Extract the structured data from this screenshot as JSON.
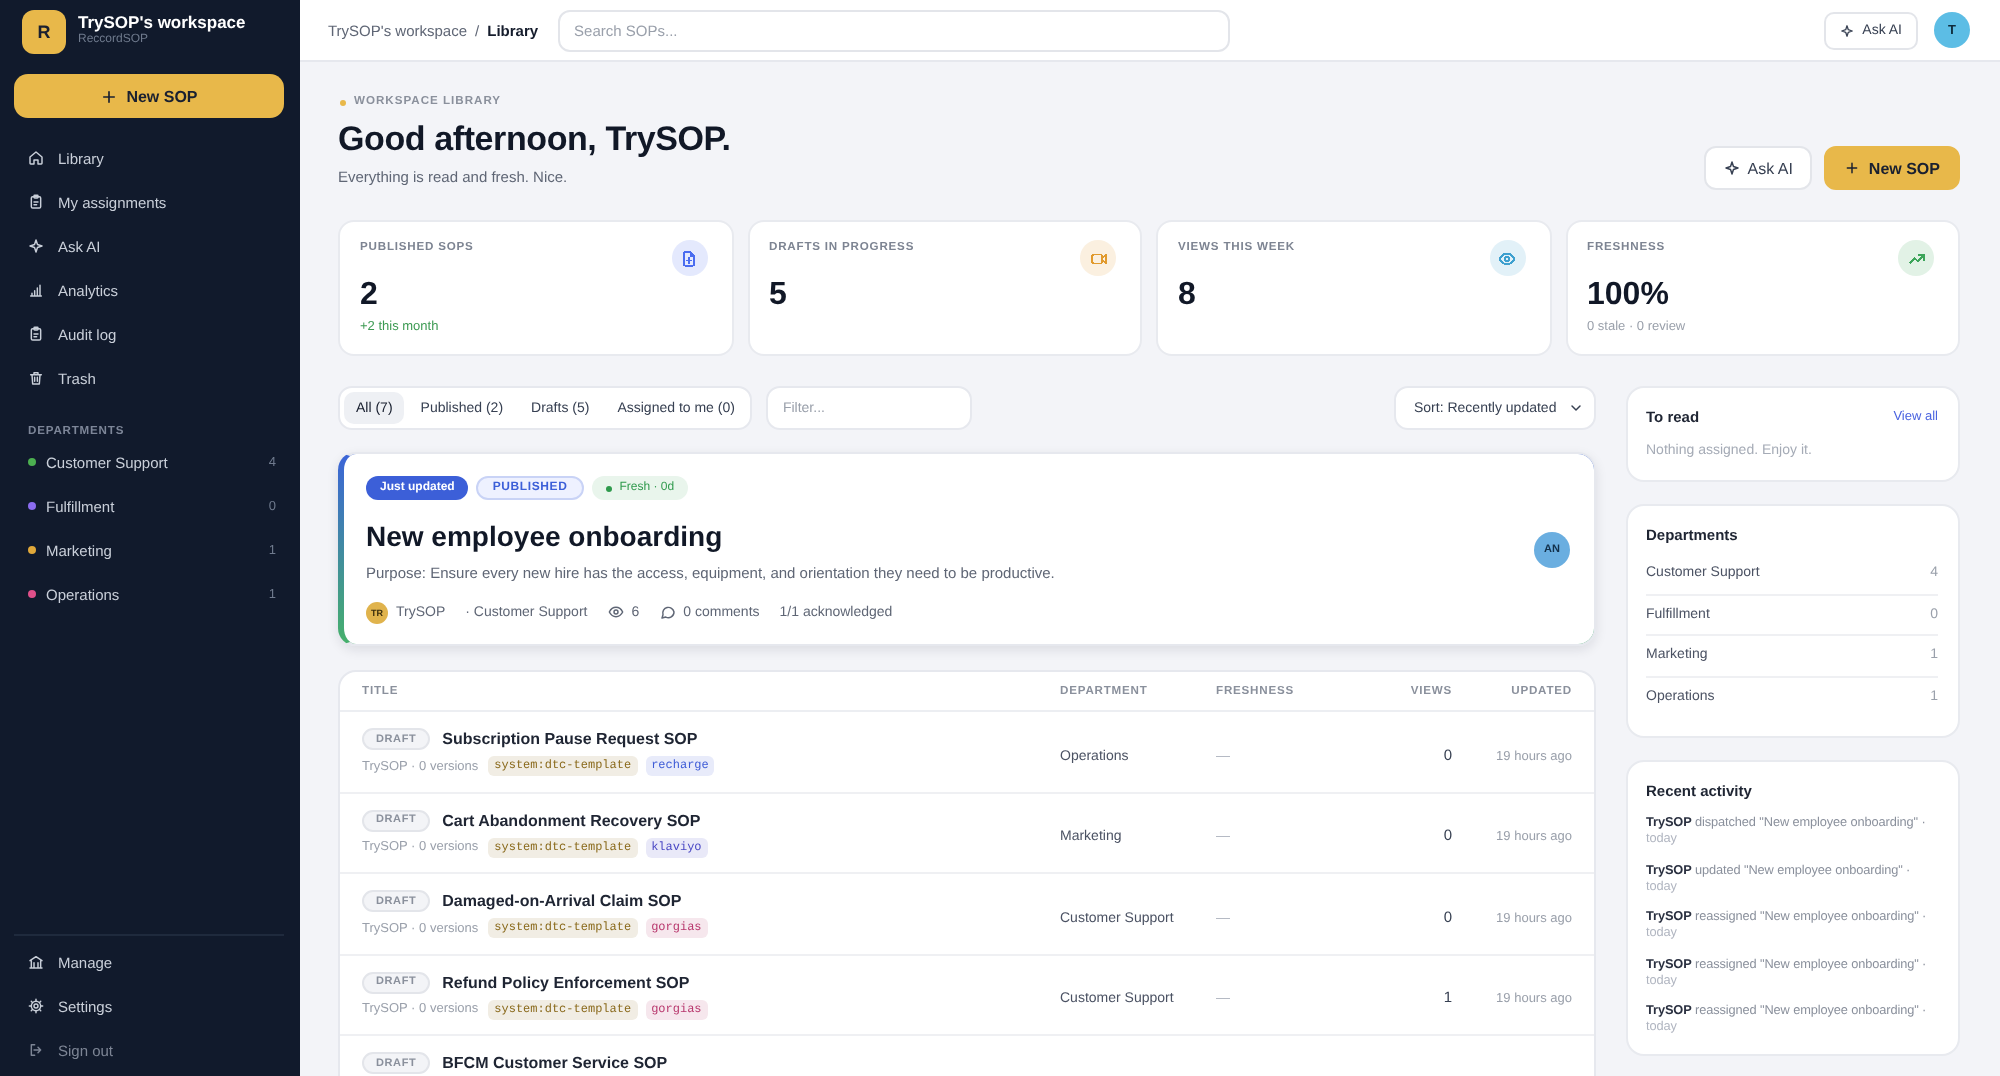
{
  "sidebar": {
    "workspace": {
      "logo_letter": "R",
      "name": "TrySOP's workspace",
      "product": "ReccordSOP"
    },
    "new_button": "New SOP",
    "nav": [
      {
        "label": "Library"
      },
      {
        "label": "My assignments"
      },
      {
        "label": "Ask AI"
      },
      {
        "label": "Analytics"
      },
      {
        "label": "Audit log"
      },
      {
        "label": "Trash"
      }
    ],
    "departments_heading": "DEPARTMENTS",
    "departments": [
      {
        "name": "Customer Support",
        "count": "4",
        "color": "#4caf50"
      },
      {
        "name": "Fulfillment",
        "count": "0",
        "color": "#8b6cf0"
      },
      {
        "name": "Marketing",
        "count": "1",
        "color": "#e0a83a"
      },
      {
        "name": "Operations",
        "count": "1",
        "color": "#e0508a"
      }
    ],
    "footer_nav": [
      {
        "label": "Manage",
        "dimmed": false
      },
      {
        "label": "Settings",
        "dimmed": false
      },
      {
        "label": "Sign out",
        "dimmed": true
      }
    ]
  },
  "topbar": {
    "breadcrumb": [
      {
        "label": "TrySOP's workspace",
        "current": false
      },
      {
        "label": "Library",
        "current": true
      }
    ],
    "separator": "/",
    "search": {
      "placeholder": "Search SOPs..."
    },
    "ask_ai": "Ask AI",
    "avatar": "T"
  },
  "header": {
    "eyebrow": "WORKSPACE LIBRARY",
    "title": "Good afternoon, TrySOP.",
    "subtitle": "Everything is read and fresh. Nice.",
    "buttons": [
      {
        "label": "Ask AI",
        "kind": "secondary"
      },
      {
        "label": "New SOP",
        "kind": "primary"
      }
    ]
  },
  "stats": [
    {
      "label": "PUBLISHED SOPS",
      "value": "2",
      "note": "+2 this month",
      "note_positive": true,
      "color": "#4a6cf0"
    },
    {
      "label": "DRAFTS IN PROGRESS",
      "value": "5",
      "color": "#e19a2d"
    },
    {
      "label": "VIEWS THIS WEEK",
      "value": "8",
      "color": "#3ea0cf"
    },
    {
      "label": "FRESHNESS",
      "value": "100%",
      "note": "0 stale · 0 review",
      "note_positive": false,
      "color": "#3da55a"
    }
  ],
  "filters": {
    "tabs": [
      {
        "label": "All (7)",
        "selected": true
      },
      {
        "label": "Published (2)",
        "selected": false
      },
      {
        "label": "Drafts (5)",
        "selected": false
      },
      {
        "label": "Assigned to me (0)",
        "selected": false
      }
    ],
    "filter_placeholder": "Filter...",
    "sort": "Sort: Recently updated"
  },
  "featured": {
    "badges": [
      {
        "label": "Just updated",
        "kind": "highlight"
      },
      {
        "label": "PUBLISHED",
        "kind": "status"
      },
      {
        "label": "Fresh · 0d",
        "kind": "fresh"
      }
    ],
    "title": "New employee onboarding",
    "purpose": "Purpose: Ensure every new hire has the access, equipment, and orientation they need to be productive.",
    "author_initials": "TR",
    "author": "TrySOP",
    "department": "· Customer Support",
    "views": "6",
    "comments": "0 comments",
    "acknowledged": "1/1 acknowledged",
    "assignee_initials": "AN"
  },
  "table": {
    "columns": [
      "TITLE",
      "DEPARTMENT",
      "FRESHNESS",
      "VIEWS",
      "UPDATED"
    ],
    "rows": [
      {
        "status": "DRAFT",
        "title": "Subscription Pause Request SOP",
        "meta": "TrySOP · 0 versions",
        "tags": [
          {
            "label": "system:dtc-template",
            "color": "#8a6a1c"
          },
          {
            "label": "recharge",
            "color": "#3d5bd6"
          }
        ],
        "department": "Operations",
        "freshness": "—",
        "views": "0",
        "updated": "19 hours ago"
      },
      {
        "status": "DRAFT",
        "title": "Cart Abandonment Recovery SOP",
        "meta": "TrySOP · 0 versions",
        "tags": [
          {
            "label": "system:dtc-template",
            "color": "#8a6a1c"
          },
          {
            "label": "klaviyo",
            "color": "#4a48c4"
          }
        ],
        "department": "Marketing",
        "freshness": "—",
        "views": "0",
        "updated": "19 hours ago"
      },
      {
        "status": "DRAFT",
        "title": "Damaged-on-Arrival Claim SOP",
        "meta": "TrySOP · 0 versions",
        "tags": [
          {
            "label": "system:dtc-template",
            "color": "#8a6a1c"
          },
          {
            "label": "gorgias",
            "color": "#b8376d"
          }
        ],
        "department": "Customer Support",
        "freshness": "—",
        "views": "0",
        "updated": "19 hours ago"
      },
      {
        "status": "DRAFT",
        "title": "Refund Policy Enforcement SOP",
        "meta": "TrySOP · 0 versions",
        "tags": [
          {
            "label": "system:dtc-template",
            "color": "#8a6a1c"
          },
          {
            "label": "gorgias",
            "color": "#b8376d"
          }
        ],
        "department": "Customer Support",
        "freshness": "—",
        "views": "1",
        "updated": "19 hours ago"
      },
      {
        "status": "DRAFT",
        "title": "BFCM Customer Service SOP"
      }
    ]
  },
  "right": {
    "to_read": {
      "title": "To read",
      "link": "View all",
      "empty": "Nothing assigned. Enjoy it."
    },
    "departments": {
      "title": "Departments",
      "items": [
        {
          "name": "Customer Support",
          "count": "4"
        },
        {
          "name": "Fulfillment",
          "count": "0"
        },
        {
          "name": "Marketing",
          "count": "1"
        },
        {
          "name": "Operations",
          "count": "1"
        }
      ]
    },
    "activity": {
      "title": "Recent activity",
      "items": [
        {
          "text": "**TrySOP** dispatched \"New employee onboarding\" ·",
          "time": "today"
        },
        {
          "text": "**TrySOP** updated \"New employee onboarding\" ·",
          "time": "today"
        },
        {
          "text": "**TrySOP** reassigned \"New employee onboarding\" ·",
          "time": "today"
        },
        {
          "text": "**TrySOP** reassigned \"New employee onboarding\" ·",
          "time": "today"
        },
        {
          "text": "**TrySOP** reassigned \"New employee onboarding\" ·",
          "time": "today"
        }
      ]
    }
  }
}
